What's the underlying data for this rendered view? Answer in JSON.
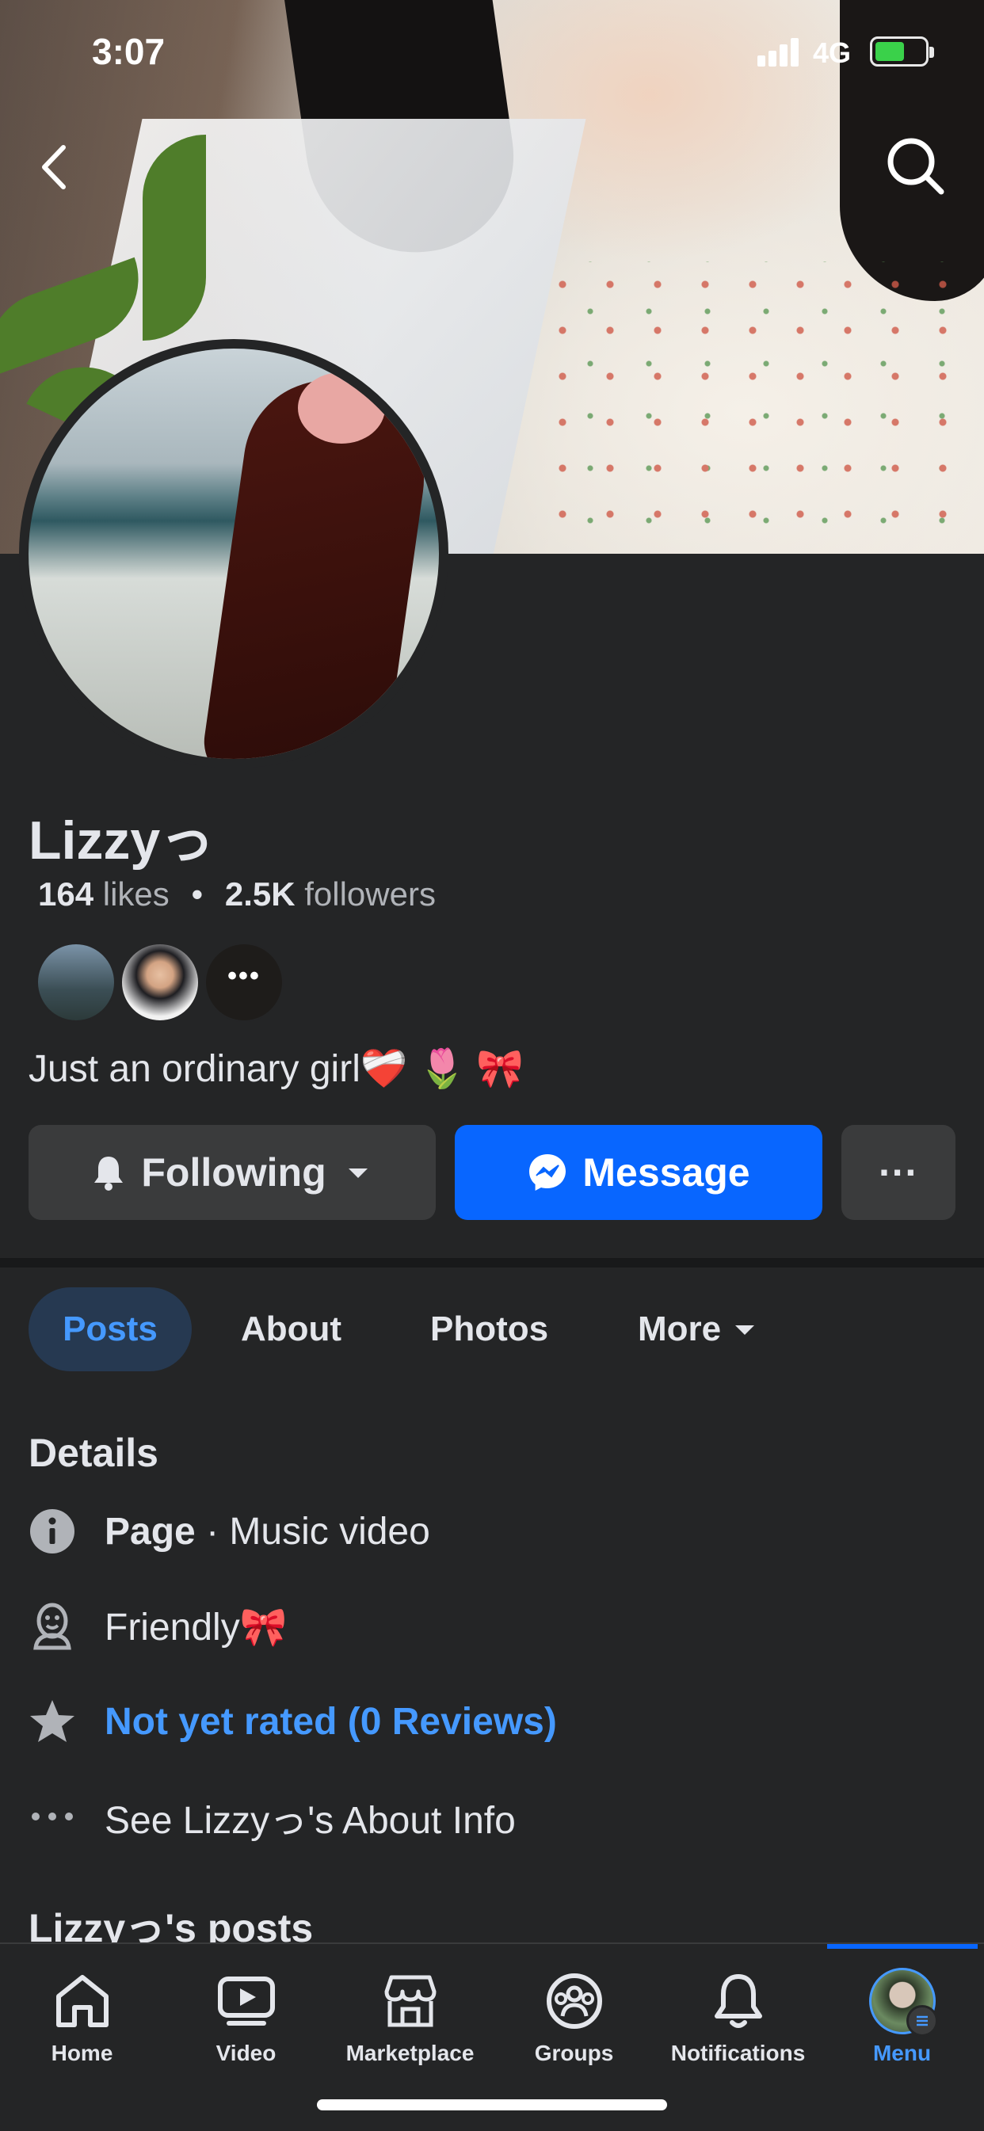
{
  "status_bar": {
    "time": "3:07",
    "network": "4G"
  },
  "profile": {
    "name": "Lizzyっ",
    "likes_count": "164",
    "likes_label": "likes",
    "separator": "•",
    "followers_count": "2.5K",
    "followers_label": "followers",
    "friends_more": "•••",
    "bio": "Just an ordinary girl❤️‍🩹 🌷 🎀"
  },
  "actions": {
    "following_label": "Following",
    "message_label": "Message",
    "more_label": "···"
  },
  "tabs": [
    {
      "label": "Posts",
      "active": true
    },
    {
      "label": "About"
    },
    {
      "label": "Photos"
    },
    {
      "label": "More"
    }
  ],
  "details": {
    "title": "Details",
    "items": [
      {
        "bold": "Page",
        "text": " · Music video",
        "icon": "info-icon"
      },
      {
        "text": "Friendly🎀",
        "icon": "mood-icon"
      },
      {
        "text": "Not yet rated (0 Reviews)",
        "icon": "star-icon",
        "link": true
      },
      {
        "text": "See Lizzyっ's About Info",
        "icon": "more-dots-icon"
      }
    ]
  },
  "posts_title": "Lizzyっ's posts",
  "bottom_nav": [
    {
      "label": "Home",
      "icon": "home-icon"
    },
    {
      "label": "Video",
      "icon": "video-icon"
    },
    {
      "label": "Marketplace",
      "icon": "marketplace-icon"
    },
    {
      "label": "Groups",
      "icon": "groups-icon"
    },
    {
      "label": "Notifications",
      "icon": "bell-icon"
    },
    {
      "label": "Menu",
      "icon": "menu-avatar",
      "active": true
    }
  ],
  "colors": {
    "background": "#242526",
    "accent": "#0866ff",
    "link": "#4599ff",
    "button_dark": "#3a3b3c",
    "battery": "#3ad14a"
  }
}
